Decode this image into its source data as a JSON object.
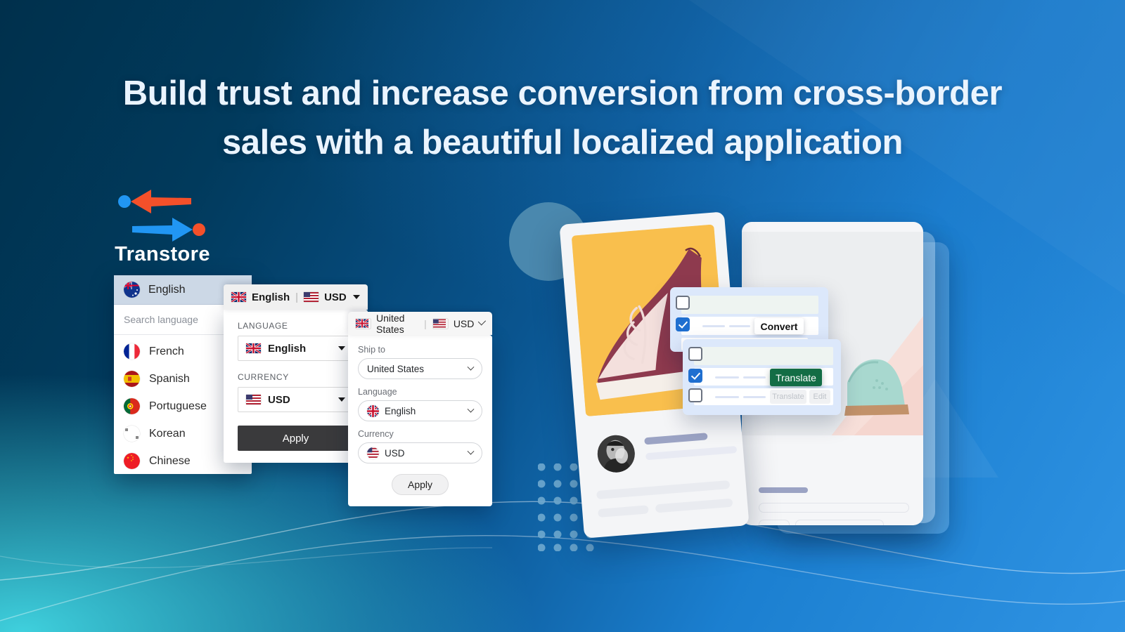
{
  "headline": {
    "line1": "Build trust and increase conversion from cross-border",
    "line2": "sales with a beautiful localized application"
  },
  "brand": {
    "name": "Transtore",
    "logo_icon": "two-way-arrows-icon"
  },
  "colors": {
    "bg_dark": "#00304c",
    "bg_blue": "#1b7fd0",
    "bg_cyan": "#3fd0dd",
    "accent_red": "#f4502a",
    "accent_blue": "#2196f3",
    "apply_dark": "#3a3a3c",
    "translate_green": "#136d45",
    "checkbox_blue": "#1f6fd0",
    "popup_bg": "#dce8fb",
    "circle_deco": "#4a88ae",
    "dot_grid": "#6fa9cf"
  },
  "language_panel": {
    "selected": {
      "label": "English",
      "flag": "au-flag-icon"
    },
    "search_placeholder": "Search language",
    "items": [
      {
        "label": "French",
        "flag": "fr-flag-icon"
      },
      {
        "label": "Spanish",
        "flag": "es-flag-icon"
      },
      {
        "label": "Portuguese",
        "flag": "pt-flag-icon"
      },
      {
        "label": "Korean",
        "flag": "kr-flag-icon"
      },
      {
        "label": "Chinese",
        "flag": "cn-flag-icon"
      }
    ]
  },
  "selector_panel": {
    "header": {
      "language": "English",
      "separator": "|",
      "currency": "USD",
      "language_flag": "gb-flag-icon",
      "currency_flag": "us-flag-icon",
      "caret_icon": "caret-down-icon"
    },
    "language_label": "LANGUAGE",
    "language_value": "English",
    "language_flag": "gb-flag-icon",
    "currency_label": "CURRENCY",
    "currency_value": "USD",
    "currency_flag": "us-flag-icon",
    "apply_label": "Apply"
  },
  "shipping_panel": {
    "header": {
      "country": "United States",
      "separator": "|",
      "currency": "USD",
      "country_flag": "gb-flag-icon",
      "currency_flag": "us-flag-icon",
      "chevron_icon": "chevron-down-icon"
    },
    "ship_to_label": "Ship to",
    "ship_to_value": "United States",
    "language_label": "Language",
    "language_value": "English",
    "language_flag": "gb-flag-icon",
    "currency_label": "Currency",
    "currency_value": "USD",
    "currency_flag": "us-flag-icon",
    "apply_label": "Apply"
  },
  "product_popups": {
    "convert_button": "Convert",
    "translate_button": "Translate",
    "ghost_translate_button": "Translate",
    "ghost_edit_button": "Edit"
  }
}
